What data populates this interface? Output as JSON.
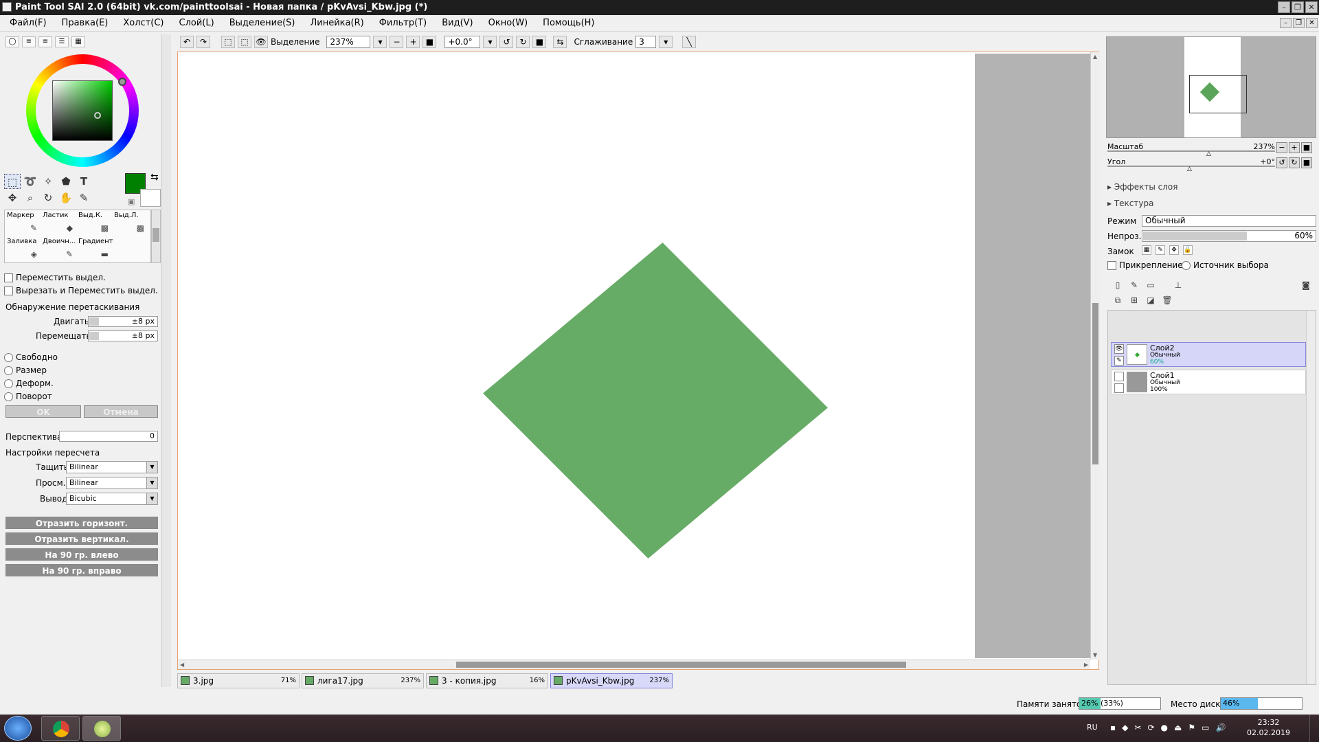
{
  "window": {
    "title": "Paint Tool SAI 2.0 (64bit) vk.com/painttoolsai - Новая папка / pKvAvsi_Kbw.jpg (*)"
  },
  "menu": [
    "Файл(F)",
    "Правка(E)",
    "Холст(C)",
    "Слой(L)",
    "Выделение(S)",
    "Линейка(R)",
    "Фильтр(T)",
    "Вид(V)",
    "Окно(W)",
    "Помощь(H)"
  ],
  "left": {
    "brushes": [
      {
        "label": "Маркер",
        "icon": "marker-icon"
      },
      {
        "label": "Ластик",
        "icon": "eraser-icon"
      },
      {
        "label": "Выд.К.",
        "icon": "select-pen-icon"
      },
      {
        "label": "Выд.Л.",
        "icon": "select-eraser-icon"
      },
      {
        "label": "Заливка",
        "icon": "bucket-icon"
      },
      {
        "label": "Двоичн...",
        "icon": "binary-pen-icon"
      },
      {
        "label": "Градиент",
        "icon": "gradient-icon"
      }
    ],
    "move_selection": "Переместить выдел.",
    "cut_move_selection": "Вырезать и Переместить выдел.",
    "drag_detect_title": "Обнаружение перетаскивания",
    "drag_label": "Двигать",
    "drag_value": "±8 px",
    "move_label": "Перемещать",
    "move_value": "±8 px",
    "modes": [
      "Свободно",
      "Размер",
      "Деформ.",
      "Поворот"
    ],
    "ok": "OK",
    "cancel": "Отмена",
    "perspective_label": "Перспектива",
    "perspective_value": "0",
    "resample_title": "Настройки пересчета",
    "drag_q_label": "Тащить",
    "drag_q_value": "Bilinear",
    "preview_label": "Просм.",
    "preview_value": "Bilinear",
    "output_label": "Вывод",
    "output_value": "Bicubic",
    "flip_h": "Отразить горизонт.",
    "flip_v": "Отразить вертикал.",
    "rot_left": "На 90 гр. влево",
    "rot_right": "На 90 гр. вправо",
    "current_color": "#008000"
  },
  "toolbar": {
    "selection_label": "Выделение",
    "zoom": "237%",
    "angle": "+0.0°",
    "smoothing_label": "Сглаживание",
    "smoothing_value": "3"
  },
  "tabs": [
    {
      "name": "3.jpg",
      "zoom": "71%"
    },
    {
      "name": "лига17.jpg",
      "zoom": "237%"
    },
    {
      "name": "3 - копия.jpg",
      "zoom": "16%"
    },
    {
      "name": "pKvAvsi_Kbw.jpg",
      "zoom": "237%"
    }
  ],
  "status": {
    "memory_label": "Памяти занято",
    "memory_value": "26% (33%)",
    "memory_fraction": 0.26,
    "disk_label": "Место диска",
    "disk_value": "46%",
    "disk_fraction": 0.46
  },
  "right": {
    "scale_label": "Масштаб",
    "scale_value": "237%",
    "angle_label": "Угол",
    "angle_value": "+0°",
    "effects": "Эффекты слоя",
    "texture": "Текстура",
    "mode_label": "Режим",
    "mode_value": "Обычный",
    "opacity_label": "Непроз.",
    "opacity_value": "60%",
    "opacity_fraction": 0.6,
    "lock_label": "Замок",
    "clip_label": "Прикрепление",
    "source_label": "Источник выбора",
    "layers": [
      {
        "name": "Слой2",
        "mode": "Обычный",
        "opacity": "60%"
      },
      {
        "name": "Слой1",
        "mode": "Обычный",
        "opacity": "100%"
      }
    ]
  },
  "taskbar": {
    "lang": "RU",
    "time": "23:32",
    "date": "02.02.2019"
  }
}
